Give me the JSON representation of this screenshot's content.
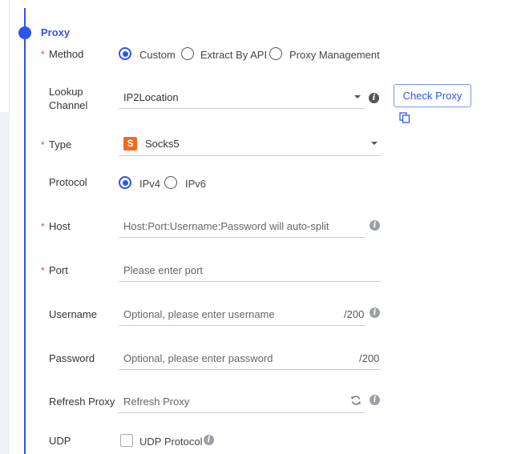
{
  "section": {
    "title": "Proxy"
  },
  "method": {
    "label": "Method",
    "required": "*",
    "options": [
      "Custom",
      "Extract By API",
      "Proxy Management"
    ],
    "selected": "Custom"
  },
  "lookup": {
    "label_line1": "Lookup",
    "label_line2": "Channel",
    "value": "IP2Location",
    "check_button": "Check Proxy"
  },
  "type": {
    "label": "Type",
    "required": "*",
    "value": "Socks5",
    "icon_letter": "S"
  },
  "protocol": {
    "label": "Protocol",
    "options": [
      "IPv4",
      "IPv6"
    ],
    "selected": "IPv4"
  },
  "host": {
    "label": "Host",
    "required": "*",
    "placeholder": "Host:Port:Username:Password will auto-split"
  },
  "port": {
    "label": "Port",
    "required": "*",
    "placeholder": "Please enter port"
  },
  "username": {
    "label": "Username",
    "placeholder": "Optional, please enter username",
    "counter": "/200"
  },
  "password": {
    "label": "Password",
    "placeholder": "Optional, please enter password",
    "counter": "/200"
  },
  "refresh": {
    "label": "Refresh Proxy",
    "placeholder": "Refresh Proxy"
  },
  "udp": {
    "label": "UDP",
    "checkbox_label": "UDP Protocol",
    "checked": false
  },
  "info_glyph": "i",
  "colors": {
    "accent": "#2f54eb",
    "required": "#e5484d",
    "socks_icon": "#f06b1f"
  }
}
